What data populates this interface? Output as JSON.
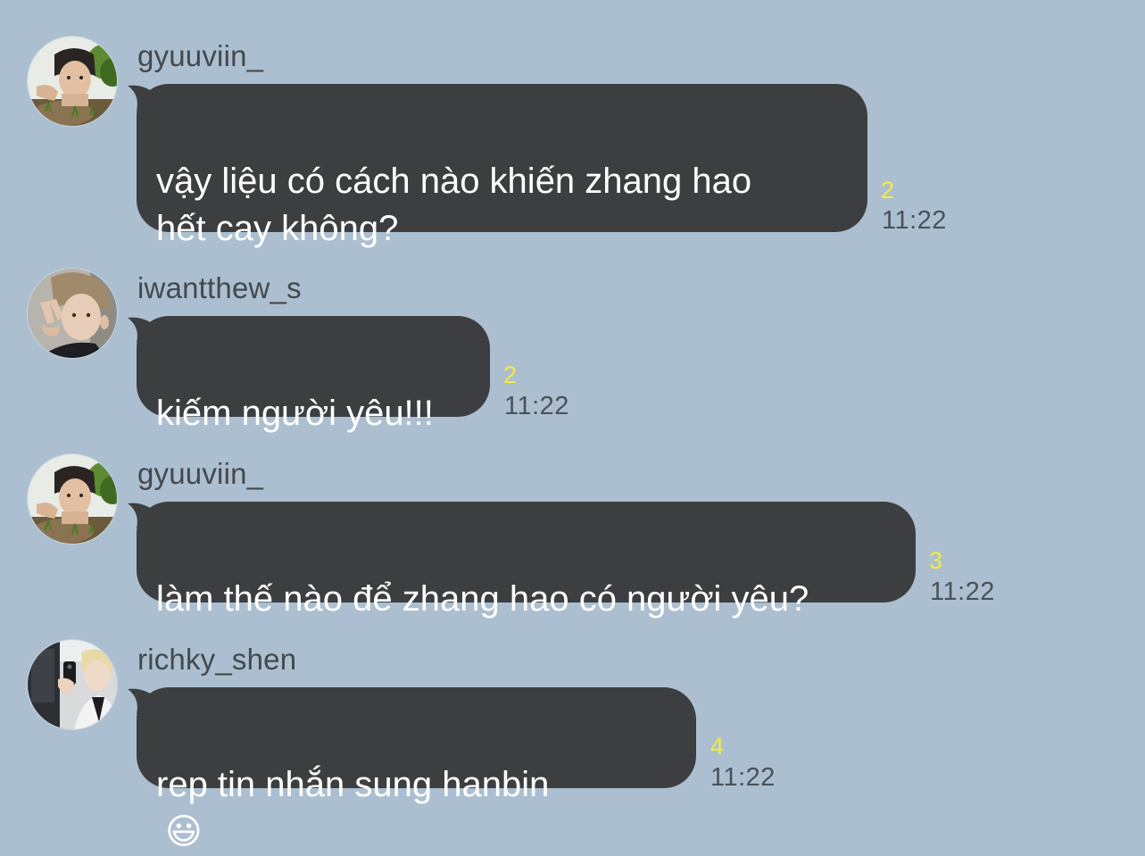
{
  "messages": [
    {
      "username": "gyuuviin_",
      "text": "vậy liệu có cách nào khiến zhang hao\nhết cay không?",
      "unread": "2",
      "time": "11:22",
      "avatar_icon": "avatar-gyuuviin-icon"
    },
    {
      "username": "iwantthew_s",
      "text": "kiếm người yêu!!!",
      "unread": "2",
      "time": "11:22",
      "avatar_icon": "avatar-iwantthew-icon"
    },
    {
      "username": "gyuuviin_",
      "text": "làm thế nào để zhang hao có người yêu?",
      "unread": "3",
      "time": "11:22",
      "avatar_icon": "avatar-gyuuviin-icon"
    },
    {
      "username": "richky_shen",
      "text": "rep tin nhắn sung hanbin",
      "emoji": "😃",
      "unread": "4",
      "time": "11:22",
      "avatar_icon": "avatar-richky-icon"
    }
  ],
  "colors": {
    "background": "#abbfd0",
    "bubble": "#3d3e40",
    "bubble_text": "#ffffff",
    "unread_count": "#f7ea3c",
    "timestamp": "#4a5159",
    "username": "#45484c"
  }
}
